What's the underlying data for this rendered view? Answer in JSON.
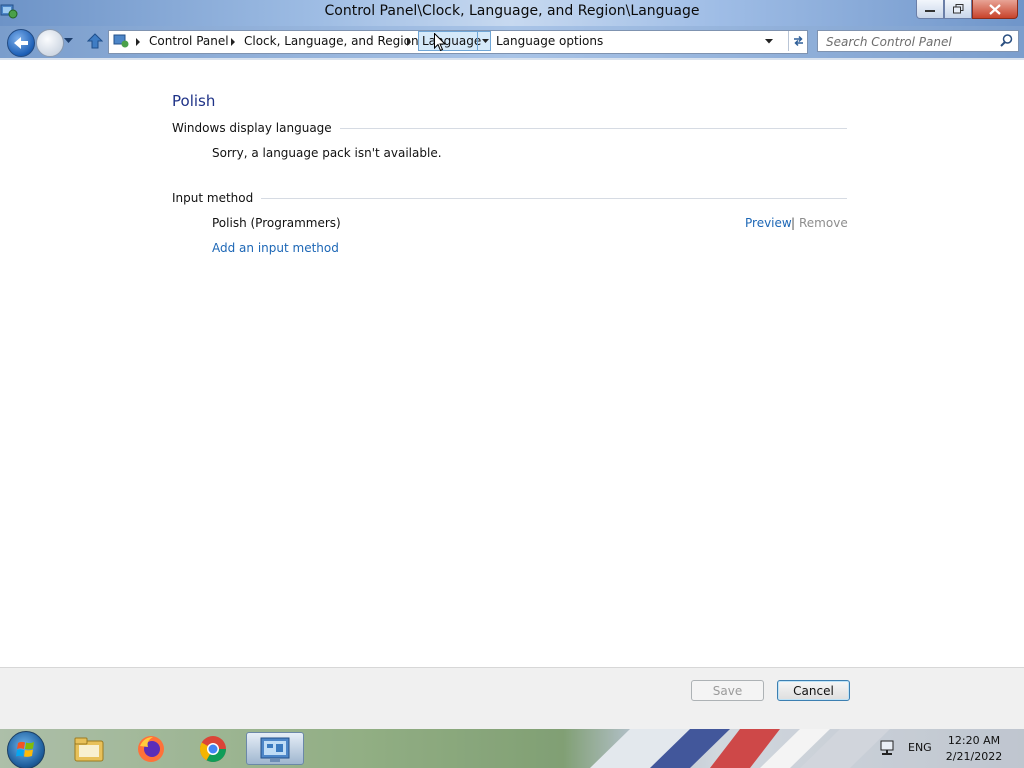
{
  "window": {
    "title": "Control Panel\\Clock, Language, and Region\\Language"
  },
  "navbar": {
    "breadcrumbs": [
      "Control Panel",
      "Clock, Language, and Region",
      "Language"
    ],
    "address_extra": "Language options",
    "search_placeholder": "Search Control Panel"
  },
  "main": {
    "title": "Polish",
    "display_language": {
      "heading": "Windows display language",
      "message": "Sorry, a language pack isn't available."
    },
    "input_method": {
      "heading": "Input method",
      "item": "Polish (Programmers)",
      "preview_label": "Preview",
      "separator": "|",
      "remove_label": "Remove",
      "add_label": "Add an input method"
    }
  },
  "footer": {
    "save_label": "Save",
    "cancel_label": "Cancel"
  },
  "taskbar": {
    "language": "ENG",
    "time": "12:20 AM",
    "date": "2/21/2022",
    "icons": [
      "start-orb-icon",
      "file-explorer-icon",
      "firefox-icon",
      "chrome-icon",
      "control-panel-icon"
    ]
  },
  "colors": {
    "heading": "#1e3287",
    "link": "#1d67b6",
    "disabled": "#8d8d8d"
  }
}
